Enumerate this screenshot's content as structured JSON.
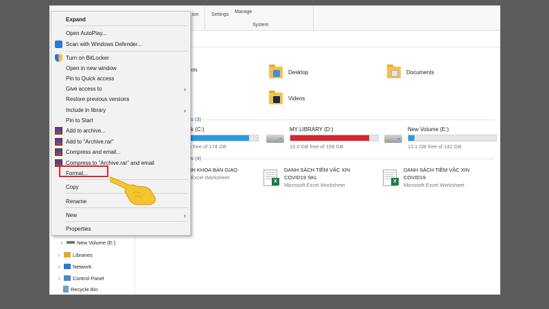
{
  "ribbon": {
    "settings_label": "Settings",
    "manage_label": "Manage",
    "tab_partial": "ion",
    "system_group": "System"
  },
  "context_menu": {
    "items": [
      {
        "label": "Expand",
        "bold": true
      },
      {
        "label": "Open AutoPlay..."
      },
      {
        "label": "Scan with Windows Defender...",
        "icon": "windows-defender-icon"
      },
      {
        "label": "Turn on BitLocker",
        "icon": "shield-icon"
      },
      {
        "label": "Open in new window"
      },
      {
        "label": "Pin to Quick access"
      },
      {
        "label": "Give access to",
        "submenu": true
      },
      {
        "label": "Restore previous versions"
      },
      {
        "label": "Include in library",
        "submenu": true
      },
      {
        "label": "Pin to Start"
      },
      {
        "label": "Add to archive...",
        "icon": "winrar-icon"
      },
      {
        "label": "Add to \"Archive.rar\"",
        "icon": "winrar-icon"
      },
      {
        "label": "Compress and email...",
        "icon": "winrar-icon"
      },
      {
        "label": "Compress to \"Archive.rar\" and email",
        "icon": "winrar-icon"
      },
      {
        "label": "Format..."
      },
      {
        "label": "Copy"
      },
      {
        "label": "Rename"
      },
      {
        "label": "New",
        "submenu": true
      },
      {
        "label": "Properties"
      }
    ],
    "submenu_glyph": "›"
  },
  "content": {
    "folders_head_partial": "ects",
    "folders": [
      {
        "name": "Desktop",
        "glyph_color": "#3f8fd8"
      },
      {
        "name": "Documents",
        "glyph_color": "#dfe6ee"
      },
      {
        "name": "Videos",
        "glyph_color": "#1f2a4a"
      }
    ],
    "devices_head_partial": "s (3)",
    "drives": [
      {
        "name_partial": "sk (C:)",
        "free_partial": "B free of 174 GB",
        "used_fraction": 0.87,
        "bar_color": "#2b9ae0"
      },
      {
        "name": "MY LIBRARY (D:)",
        "free": "15.0 GB free of 159 GB",
        "used_fraction": 0.9,
        "bar_color": "#d9252c"
      },
      {
        "name": "New Volume (E:)",
        "free": "13.1 GB free of 142 GB",
        "used_fraction": 0.07,
        "bar_color": "#2b9ae0"
      }
    ],
    "recent_head_partial": "s (4)",
    "files": [
      {
        "line1": "NH KHOA BÀN GIAO",
        "line2": "",
        "type": "t Excel Worksheet"
      },
      {
        "line1": "DANH SÁCH TIÊM VẮC XIN",
        "line2": "COVID19 SKL",
        "type": "Microsoft Excel Worksheet"
      },
      {
        "line1": "DANH SÁCH TIÊM VẮC XIN",
        "line2": "COVID19",
        "type": "Microsoft Excel Worksheet"
      }
    ],
    "excel_badge": "X"
  },
  "nav_pane": {
    "items": [
      {
        "label": "New Volume (E:)",
        "icon": "drive-icon",
        "color": "#777777"
      },
      {
        "label": "Libraries",
        "icon": "libraries-icon",
        "color": "#e0aa34"
      },
      {
        "label": "Network",
        "icon": "network-icon",
        "color": "#2b77d6"
      },
      {
        "label": "Control Panel",
        "icon": "control-panel-icon",
        "color": "#3b8fd0"
      },
      {
        "label": "Recycle Bin",
        "icon": "recycle-bin-icon",
        "color": "#6aa0c8"
      }
    ],
    "chevron": "›"
  },
  "colors": {
    "highlight_border": "#d9252c",
    "hand": "#f4c430"
  }
}
